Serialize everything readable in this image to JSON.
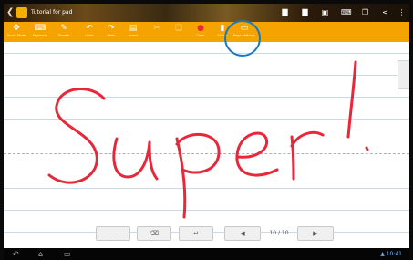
{
  "window": {
    "title": "Tutorial for pad"
  },
  "status_icons": [
    "document-icon",
    "document-icon",
    "gallery-icon",
    "keyboard-icon",
    "copy-icon",
    "share-icon",
    "menu-icon"
  ],
  "toolbar": {
    "items": [
      {
        "label": "Scroll Mode",
        "icon": "scroll-icon"
      },
      {
        "label": "Keyboard",
        "icon": "keyboard-icon"
      },
      {
        "label": "Doodle",
        "icon": "pen-icon"
      },
      {
        "label": "Undo",
        "icon": "undo-icon"
      },
      {
        "label": "Redo",
        "icon": "redo-icon"
      },
      {
        "label": "Insert",
        "icon": "insert-icon"
      },
      {
        "label": "",
        "icon": "cut-icon"
      },
      {
        "label": "",
        "icon": "paste-icon"
      },
      {
        "label": "Color",
        "icon": "color-icon"
      },
      {
        "label": "Stroke",
        "icon": "stroke-icon"
      },
      {
        "label": "Page Settings",
        "icon": "page-settings-icon"
      }
    ],
    "highlight_item": "Page Settings"
  },
  "canvas": {
    "handwritten_text": "Super!",
    "ink_color": "#e8283a",
    "rule_color": "#c9d9ee"
  },
  "bottom_controls": {
    "space_label": "—",
    "backspace_label": "⌫",
    "enter_label": "↵",
    "prev_label": "◀",
    "page_indicator": "10 / 10",
    "next_label": "▶"
  },
  "system_nav": {
    "back": "↶",
    "home": "⌂",
    "recents": "▭",
    "status": "▲ 10:41"
  },
  "colors": {
    "toolbar": "#f4a300",
    "highlight_ring": "#1a78c2"
  }
}
